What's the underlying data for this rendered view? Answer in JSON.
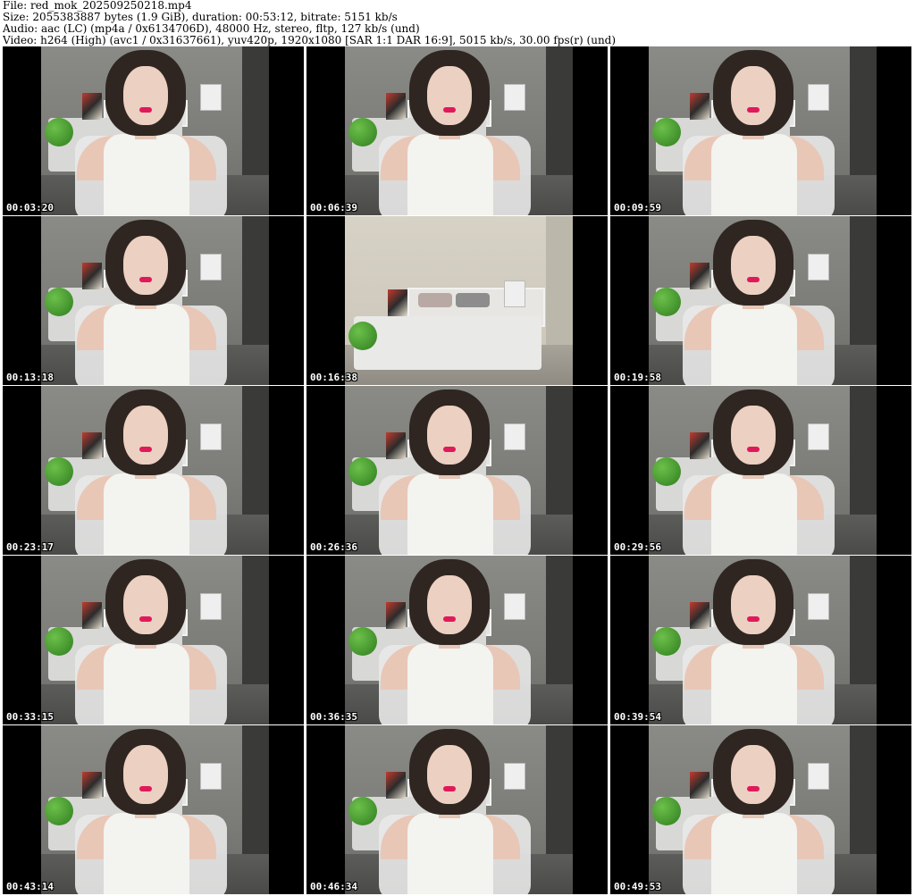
{
  "header": {
    "file": "File: red_mok_202509250218.mp4",
    "size": "Size: 2055383887 bytes (1.9 GiB), duration: 00:53:12, bitrate: 5151 kb/s",
    "audio": "Audio: aac (LC) (mp4a / 0x6134706D), 48000 Hz, stereo, fltp, 127 kb/s (und)",
    "video": "Video: h264 (High) (avc1 / 0x31637661), yuv420p, 1920x1080 [SAR 1:1 DAR 16:9], 5015 kb/s, 30.00 fps(r) (und)"
  },
  "thumbnails": [
    {
      "timestamp": "00:03:20",
      "scene": "person"
    },
    {
      "timestamp": "00:06:39",
      "scene": "person"
    },
    {
      "timestamp": "00:09:59",
      "scene": "person"
    },
    {
      "timestamp": "00:13:18",
      "scene": "person"
    },
    {
      "timestamp": "00:16:38",
      "scene": "room"
    },
    {
      "timestamp": "00:19:58",
      "scene": "person"
    },
    {
      "timestamp": "00:23:17",
      "scene": "person"
    },
    {
      "timestamp": "00:26:36",
      "scene": "person"
    },
    {
      "timestamp": "00:29:56",
      "scene": "person"
    },
    {
      "timestamp": "00:33:15",
      "scene": "person"
    },
    {
      "timestamp": "00:36:35",
      "scene": "person"
    },
    {
      "timestamp": "00:39:54",
      "scene": "person"
    },
    {
      "timestamp": "00:43:14",
      "scene": "person"
    },
    {
      "timestamp": "00:46:34",
      "scene": "person"
    },
    {
      "timestamp": "00:49:53",
      "scene": "person"
    }
  ]
}
